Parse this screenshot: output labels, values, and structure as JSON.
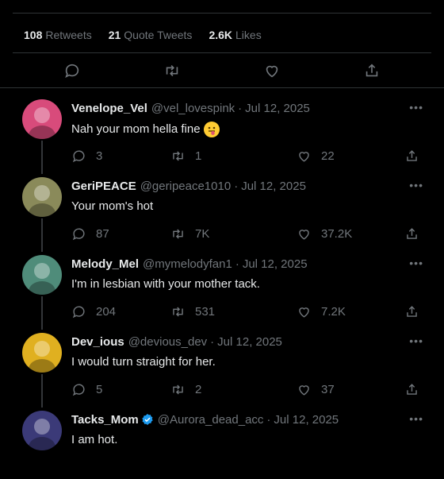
{
  "stats": {
    "retweets_count": "108",
    "retweets_label": "Retweets",
    "quotes_count": "21",
    "quotes_label": "Quote Tweets",
    "likes_count": "2.6K",
    "likes_label": "Likes"
  },
  "replies": [
    {
      "name": "Venelope_Vel",
      "handle": "@vel_lovespink",
      "date": "Jul 12, 2025",
      "text": "Nah your mom hella fine",
      "emoji": "tongue-out-emoji",
      "replies": "3",
      "retweets": "1",
      "likes": "22",
      "avatar_color": "#d84b7b"
    },
    {
      "name": "GeriPEACE",
      "handle": "@geripeace1010",
      "date": "Jul 12, 2025",
      "text": "Your mom's hot",
      "replies": "87",
      "retweets": "7K",
      "likes": "37.2K",
      "avatar_color": "#8a8a5a"
    },
    {
      "name": "Melody_Mel",
      "handle": "@mymelodyfan1",
      "date": "Jul 12, 2025",
      "text": "I'm in lesbian with your mother tack.",
      "replies": "204",
      "retweets": "531",
      "likes": "7.2K",
      "avatar_color": "#4f8c7a"
    },
    {
      "name": "Dev_ious",
      "handle": "@devious_dev",
      "date": "Jul 12, 2025",
      "text": "I would turn straight for her.",
      "replies": "5",
      "retweets": "2",
      "likes": "37",
      "avatar_color": "#e0b020"
    },
    {
      "name": "Tacks_Mom",
      "handle": "@Aurora_dead_acc",
      "date": "Jul 12, 2025",
      "text": "I am hot.",
      "verified": true,
      "avatar_color": "#3b3a78"
    }
  ],
  "separator": "·",
  "more_label": "•••",
  "colors": {
    "background": "#000000",
    "text": "#e7e9ea",
    "muted": "#71767b",
    "divider": "#2f3336",
    "verified": "#1d9bf0"
  }
}
